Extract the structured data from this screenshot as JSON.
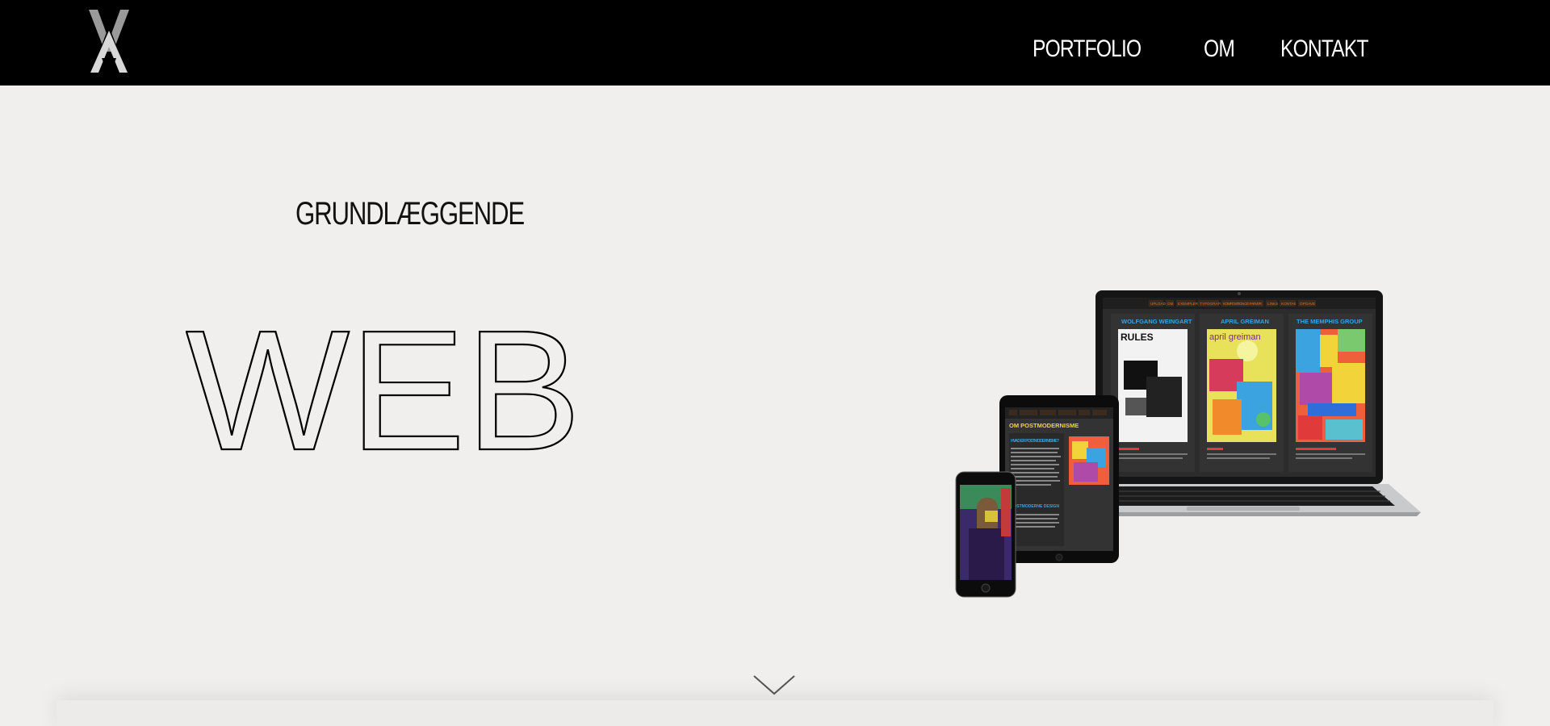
{
  "header": {
    "logo": "logo-monogram",
    "nav": [
      {
        "label": "PORTFOLIO"
      },
      {
        "label": "OM"
      },
      {
        "label": "KONTAKT"
      }
    ]
  },
  "hero": {
    "kicker": "GRUNDLÆGGENDE",
    "headline": "WEB",
    "devices_image": "responsive-devices-mockup",
    "laptop_screen": {
      "nav": [
        "UPLOAD",
        "OM",
        "EXEMPLER",
        "TYPOGRAFI",
        "KOMPOSITION OG FARVER",
        "LINKS",
        "KONTAK",
        "OPGAVE"
      ],
      "columns": [
        "WOLFGANG WEINGART",
        "APRIL GREIMAN",
        "THE MEMPHIS GROUP"
      ],
      "poster_texts": [
        "RULES",
        "april greiman"
      ]
    },
    "tablet_screen": {
      "title": "OM POSTMODERNISME",
      "sub1": "HVAD ER POSTMODERNISME?",
      "sub2": "POSTMODERNE DESIGN"
    },
    "scroll_icon": "chevron-down-icon"
  },
  "colors": {
    "bg": "#f0efed",
    "topbar": "#000000",
    "nav_text": "#ffffff",
    "screen_orange": "#e86b16",
    "screen_blue": "#3aa3e0"
  }
}
